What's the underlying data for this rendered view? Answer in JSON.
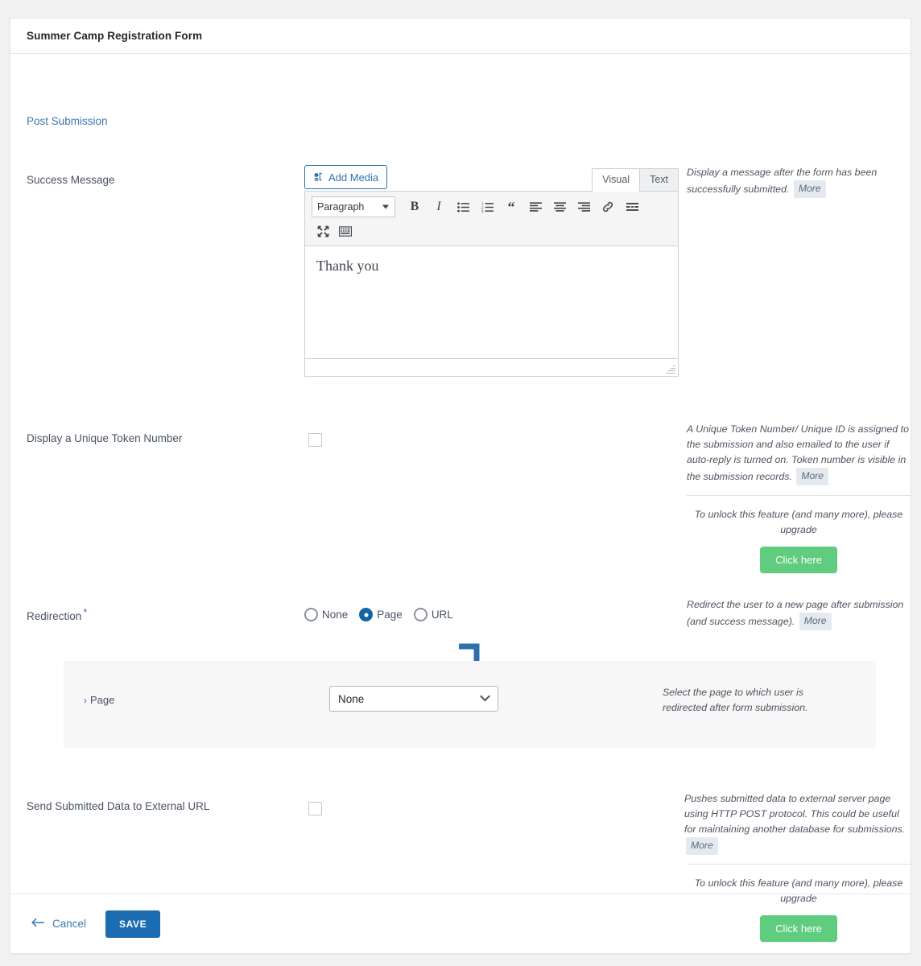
{
  "header": {
    "title": "Summer Camp Registration Form"
  },
  "section": {
    "link_label": "Post Submission"
  },
  "success_message": {
    "label": "Success Message",
    "add_media_label": "Add Media",
    "tabs": [
      {
        "label": "Visual",
        "active": true
      },
      {
        "label": "Text",
        "active": false
      }
    ],
    "format_select": "Paragraph",
    "toolbar_icons": [
      "bold-icon",
      "italic-icon",
      "bulleted-list-icon",
      "numbered-list-icon",
      "blockquote-icon",
      "align-left-icon",
      "align-center-icon",
      "align-right-icon",
      "insert-link-icon",
      "read-more-icon",
      "fullscreen-icon",
      "toolbar-toggle-icon"
    ],
    "content": "Thank you",
    "help": "Display a message after the form has been successfully submitted.",
    "more_label": "More"
  },
  "token": {
    "label": "Display a Unique Token Number",
    "checked": false,
    "help": "A Unique Token Number/ Unique ID is assigned to the submission and also emailed to the user if auto-reply is turned on. Token number is visible in the submission records.",
    "more_label": "More",
    "upgrade_text": "To unlock this feature (and many more), please upgrade",
    "upgrade_button": "Click here"
  },
  "redirection": {
    "label": "Redirection",
    "required": true,
    "options": [
      {
        "label": "None",
        "checked": false
      },
      {
        "label": "Page",
        "checked": true
      },
      {
        "label": "URL",
        "checked": false
      }
    ],
    "help": "Redirect the user to a new page after submission (and success message).",
    "more_label": "More",
    "page_sub": {
      "label": "Page",
      "selected": "None",
      "help": "Select the page to which user is redirected after form submission."
    }
  },
  "external_url": {
    "label": "Send Submitted Data to External URL",
    "checked": false,
    "help": "Pushes submitted data to external server page using HTTP POST protocol. This could be useful for maintaining another database for submissions.",
    "more_label": "More",
    "upgrade_text": "To unlock this feature (and many more), please upgrade",
    "upgrade_button": "Click here"
  },
  "footer": {
    "cancel_label": "Cancel",
    "save_label": "SAVE"
  },
  "colors": {
    "link_blue": "#3a78b5",
    "save_blue": "#1b6cb0",
    "upgrade_green": "#5fcc7e",
    "radio_blue": "#1464a5",
    "annotation_arrow": "#2c6fab"
  }
}
